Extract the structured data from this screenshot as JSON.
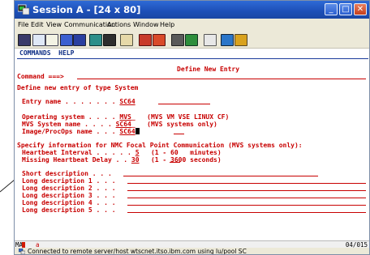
{
  "window": {
    "title": "Session A - [24 x 80]",
    "controls": {
      "minimize": "_",
      "maximize": "□",
      "close": "✕"
    }
  },
  "menu": [
    "File",
    "Edit",
    "View",
    "Communication",
    "Actions",
    "Window",
    "Help"
  ],
  "toolbar_icons": [
    "print-icon",
    "copy-icon",
    "paste-icon",
    "send-icon",
    "receive-icon",
    "display-icon",
    "color-icon",
    "chart-icon",
    "macro-record-icon",
    "macro-stop-icon",
    "play-icon",
    "stats-icon",
    "help-icon",
    "globe-icon",
    "edit-icon"
  ],
  "terminal": {
    "menu": {
      "commands": "COMMANDS",
      "help": "HELP"
    },
    "screen_title": "Define New Entry",
    "command_label": "Command ===>",
    "define_prefix": "Define new entry of type ",
    "define_type": "System",
    "entry_name": {
      "label": "Entry name . . . . . . .",
      "value": "SC64"
    },
    "operating_system": {
      "label": "Operating system . . . .",
      "value": "MVS",
      "hint": "(MVS VM VSE LINUX CF)"
    },
    "mvs_system_name": {
      "label": "MVS System name . . . .",
      "value": "SC64",
      "hint": "(MVS systems only)"
    },
    "image_procops_name": {
      "label": "Image/ProcOps name . . .",
      "value": "SC64"
    },
    "nmc_header": "Specify information for NMC Focal Point Communication (MVS systems only):",
    "heartbeat_interval": {
      "label": "Heartbeat Interval . . . . .",
      "value": "5",
      "hint": "(1 - 60   minutes)"
    },
    "missing_heartbeat": {
      "label": "Missing Heartbeat Delay . .",
      "value": "30",
      "hint": "(1 - 3600 seconds)"
    },
    "short_description": {
      "label": "Short description . . .",
      "value": ""
    },
    "long_descriptions": [
      {
        "label": "Long description 1 . . .",
        "value": ""
      },
      {
        "label": "Long description 2 . . .",
        "value": ""
      },
      {
        "label": "Long description 3 . . .",
        "value": ""
      },
      {
        "label": "Long description 4 . . .",
        "value": ""
      },
      {
        "label": "Long description 5 . . .",
        "value": ""
      }
    ]
  },
  "status": {
    "mode": "MA",
    "indicator": "a",
    "position": "04/015"
  },
  "info_bar": "Connected to remote server/host wtscnet.itso.ibm.com using lu/pool SC"
}
